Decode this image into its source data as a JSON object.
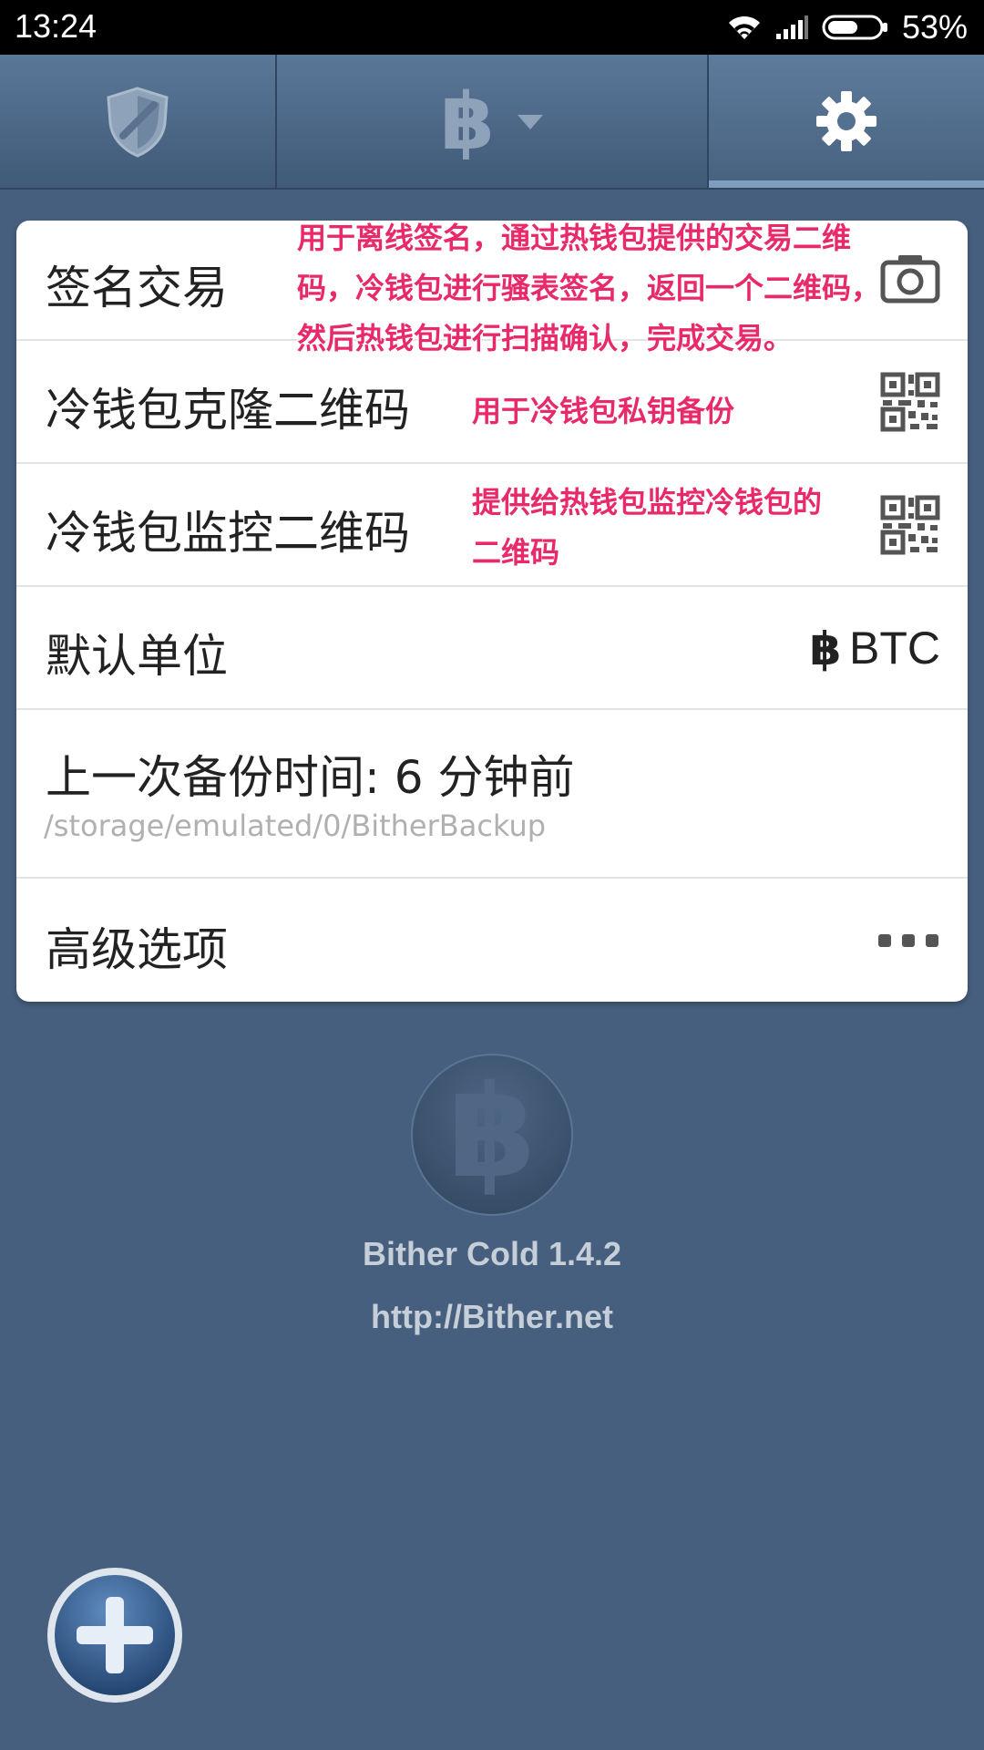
{
  "status_bar": {
    "time": "13:24",
    "battery": "53%"
  },
  "tabs": [
    {
      "name": "security",
      "icon": "shield-icon"
    },
    {
      "name": "wallet",
      "icon": "bitcoin-icon"
    },
    {
      "name": "settings",
      "icon": "gear-icon",
      "selected": true
    }
  ],
  "settings": {
    "sign_transaction": "签名交易",
    "clone_qr": "冷钱包克隆二维码",
    "monitor_qr": "冷钱包监控二维码",
    "default_unit": "默认单位",
    "default_unit_value": "BTC",
    "last_backup": "上一次备份时间: 6 分钟前",
    "backup_path": "/storage/emulated/0/BitherBackup",
    "advanced": "高级选项"
  },
  "annotations": {
    "sign_line1": "用于离线签名，通过热钱包提供的交易二维",
    "sign_line2": "码，冷钱包进行骚表签名，返回一个二维码，",
    "sign_line3": "然后热钱包进行扫描确认，完成交易。",
    "clone": "用于冷钱包私钥备份",
    "monitor_line1": "提供给热钱包监控冷钱包的",
    "monitor_line2": "二维码"
  },
  "about": {
    "app_name": "Bither Cold  1.4.2",
    "url": "http://Bither.net"
  },
  "colors": {
    "background": "#465f7e",
    "annotation": "#e8296a",
    "card": "#ffffff"
  }
}
